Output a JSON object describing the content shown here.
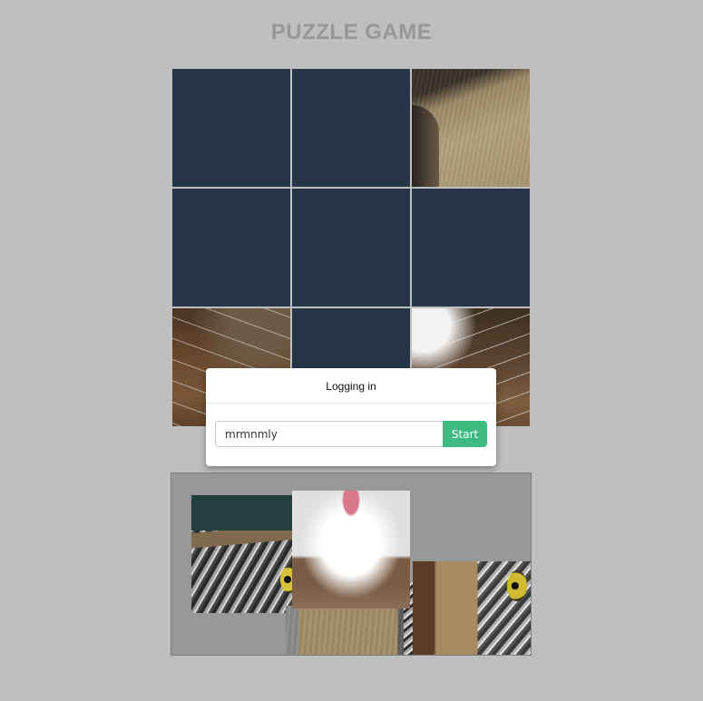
{
  "page": {
    "title": "PUZZLE GAME",
    "background_color": "#bfbfbf"
  },
  "board": {
    "empty_color": "#263548",
    "cells": [
      {
        "index": 0,
        "state": "empty"
      },
      {
        "index": 1,
        "state": "empty"
      },
      {
        "index": 2,
        "state": "filled",
        "content": "paper-bag-edge"
      },
      {
        "index": 3,
        "state": "empty"
      },
      {
        "index": 4,
        "state": "empty"
      },
      {
        "index": 5,
        "state": "empty"
      },
      {
        "index": 6,
        "state": "filled",
        "content": "cat-whiskers-left"
      },
      {
        "index": 7,
        "state": "empty"
      },
      {
        "index": 8,
        "state": "filled",
        "content": "cat-whiskers-right"
      }
    ]
  },
  "dialog": {
    "title": "Logging in",
    "name_value": "mrmnmly",
    "start_label": "Start",
    "start_color": "#3dbb83"
  },
  "tray": {
    "background_color": "#989898",
    "pieces": [
      {
        "content": "tabby-cat-under-paper"
      },
      {
        "content": "cat-nose-and-mouth"
      },
      {
        "content": "paper-bag-lower"
      },
      {
        "content": "cat-eye-right"
      },
      {
        "content": "fur-strip"
      }
    ]
  }
}
